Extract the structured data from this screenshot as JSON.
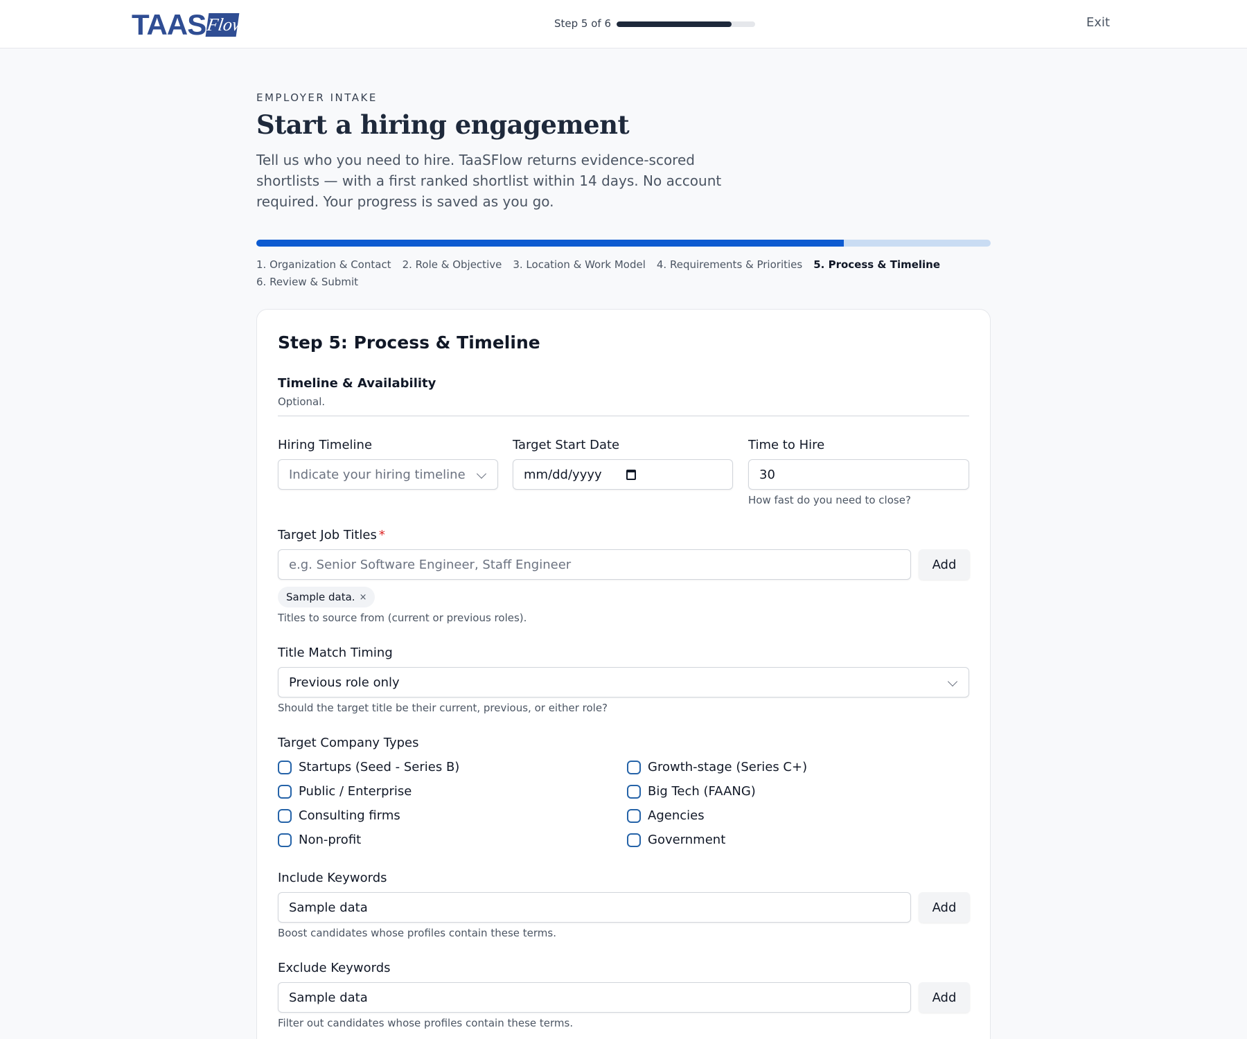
{
  "header": {
    "logo_text": "TAAS",
    "logo_flow": "Flow",
    "step_count": "Step 5 of 6",
    "progress": 0.83,
    "exit_label": "Exit"
  },
  "intro": {
    "eyebrow": "EMPLOYER INTAKE",
    "title": "Start a hiring engagement",
    "description": "Tell us who you need to hire. TaaSFlow returns evidence-scored shortlists — with a first ranked shortlist within 14 days. No account required. Your progress is saved as you go."
  },
  "progress": {
    "fraction": 0.8,
    "steps": [
      "1. Organization & Contact",
      "2. Role & Objective",
      "3. Location & Work Model",
      "4. Requirements & Priorities",
      "5. Process & Timeline",
      "6. Review & Submit"
    ],
    "active_index": 4
  },
  "form": {
    "step_title": "Step 5: Process & Timeline",
    "section_title": "Timeline & Availability",
    "section_sub": "Optional.",
    "hiring_timeline": {
      "label": "Hiring Timeline",
      "placeholder": "Indicate your hiring timeline"
    },
    "target_start_date": {
      "label": "Target Start Date",
      "placeholder": "mm/dd/yyyy"
    },
    "time_to_hire": {
      "label": "Time to Hire",
      "value": "30",
      "help": "How fast do you need to close?"
    },
    "target_job_titles": {
      "label": "Target Job Titles",
      "required_mark": "*",
      "placeholder": "e.g. Senior Software Engineer, Staff Engineer",
      "add_label": "Add",
      "chip": "Sample data.",
      "chip_remove": "×",
      "help": "Titles to source from (current or previous roles)."
    },
    "title_match_timing": {
      "label": "Title Match Timing",
      "value": "Previous role only",
      "help": "Should the target title be their current, previous, or either role?"
    },
    "company_types": {
      "label": "Target Company Types",
      "options": [
        "Startups (Seed - Series B)",
        "Growth-stage (Series C+)",
        "Public / Enterprise",
        "Big Tech (FAANG)",
        "Consulting firms",
        "Agencies",
        "Non-profit",
        "Government"
      ]
    },
    "include_keywords": {
      "label": "Include Keywords",
      "value": "Sample data",
      "add_label": "Add",
      "help": "Boost candidates whose profiles contain these terms."
    },
    "exclude_keywords": {
      "label": "Exclude Keywords",
      "value": "Sample data",
      "add_label": "Add",
      "help": "Filter out candidates whose profiles contain these terms."
    }
  },
  "colors": {
    "brand": "#2f4d93",
    "primary": "#0d5bd1",
    "progress_track": "#c9dcf3",
    "checkbox": "#2563a8",
    "required": "#dc2626"
  }
}
